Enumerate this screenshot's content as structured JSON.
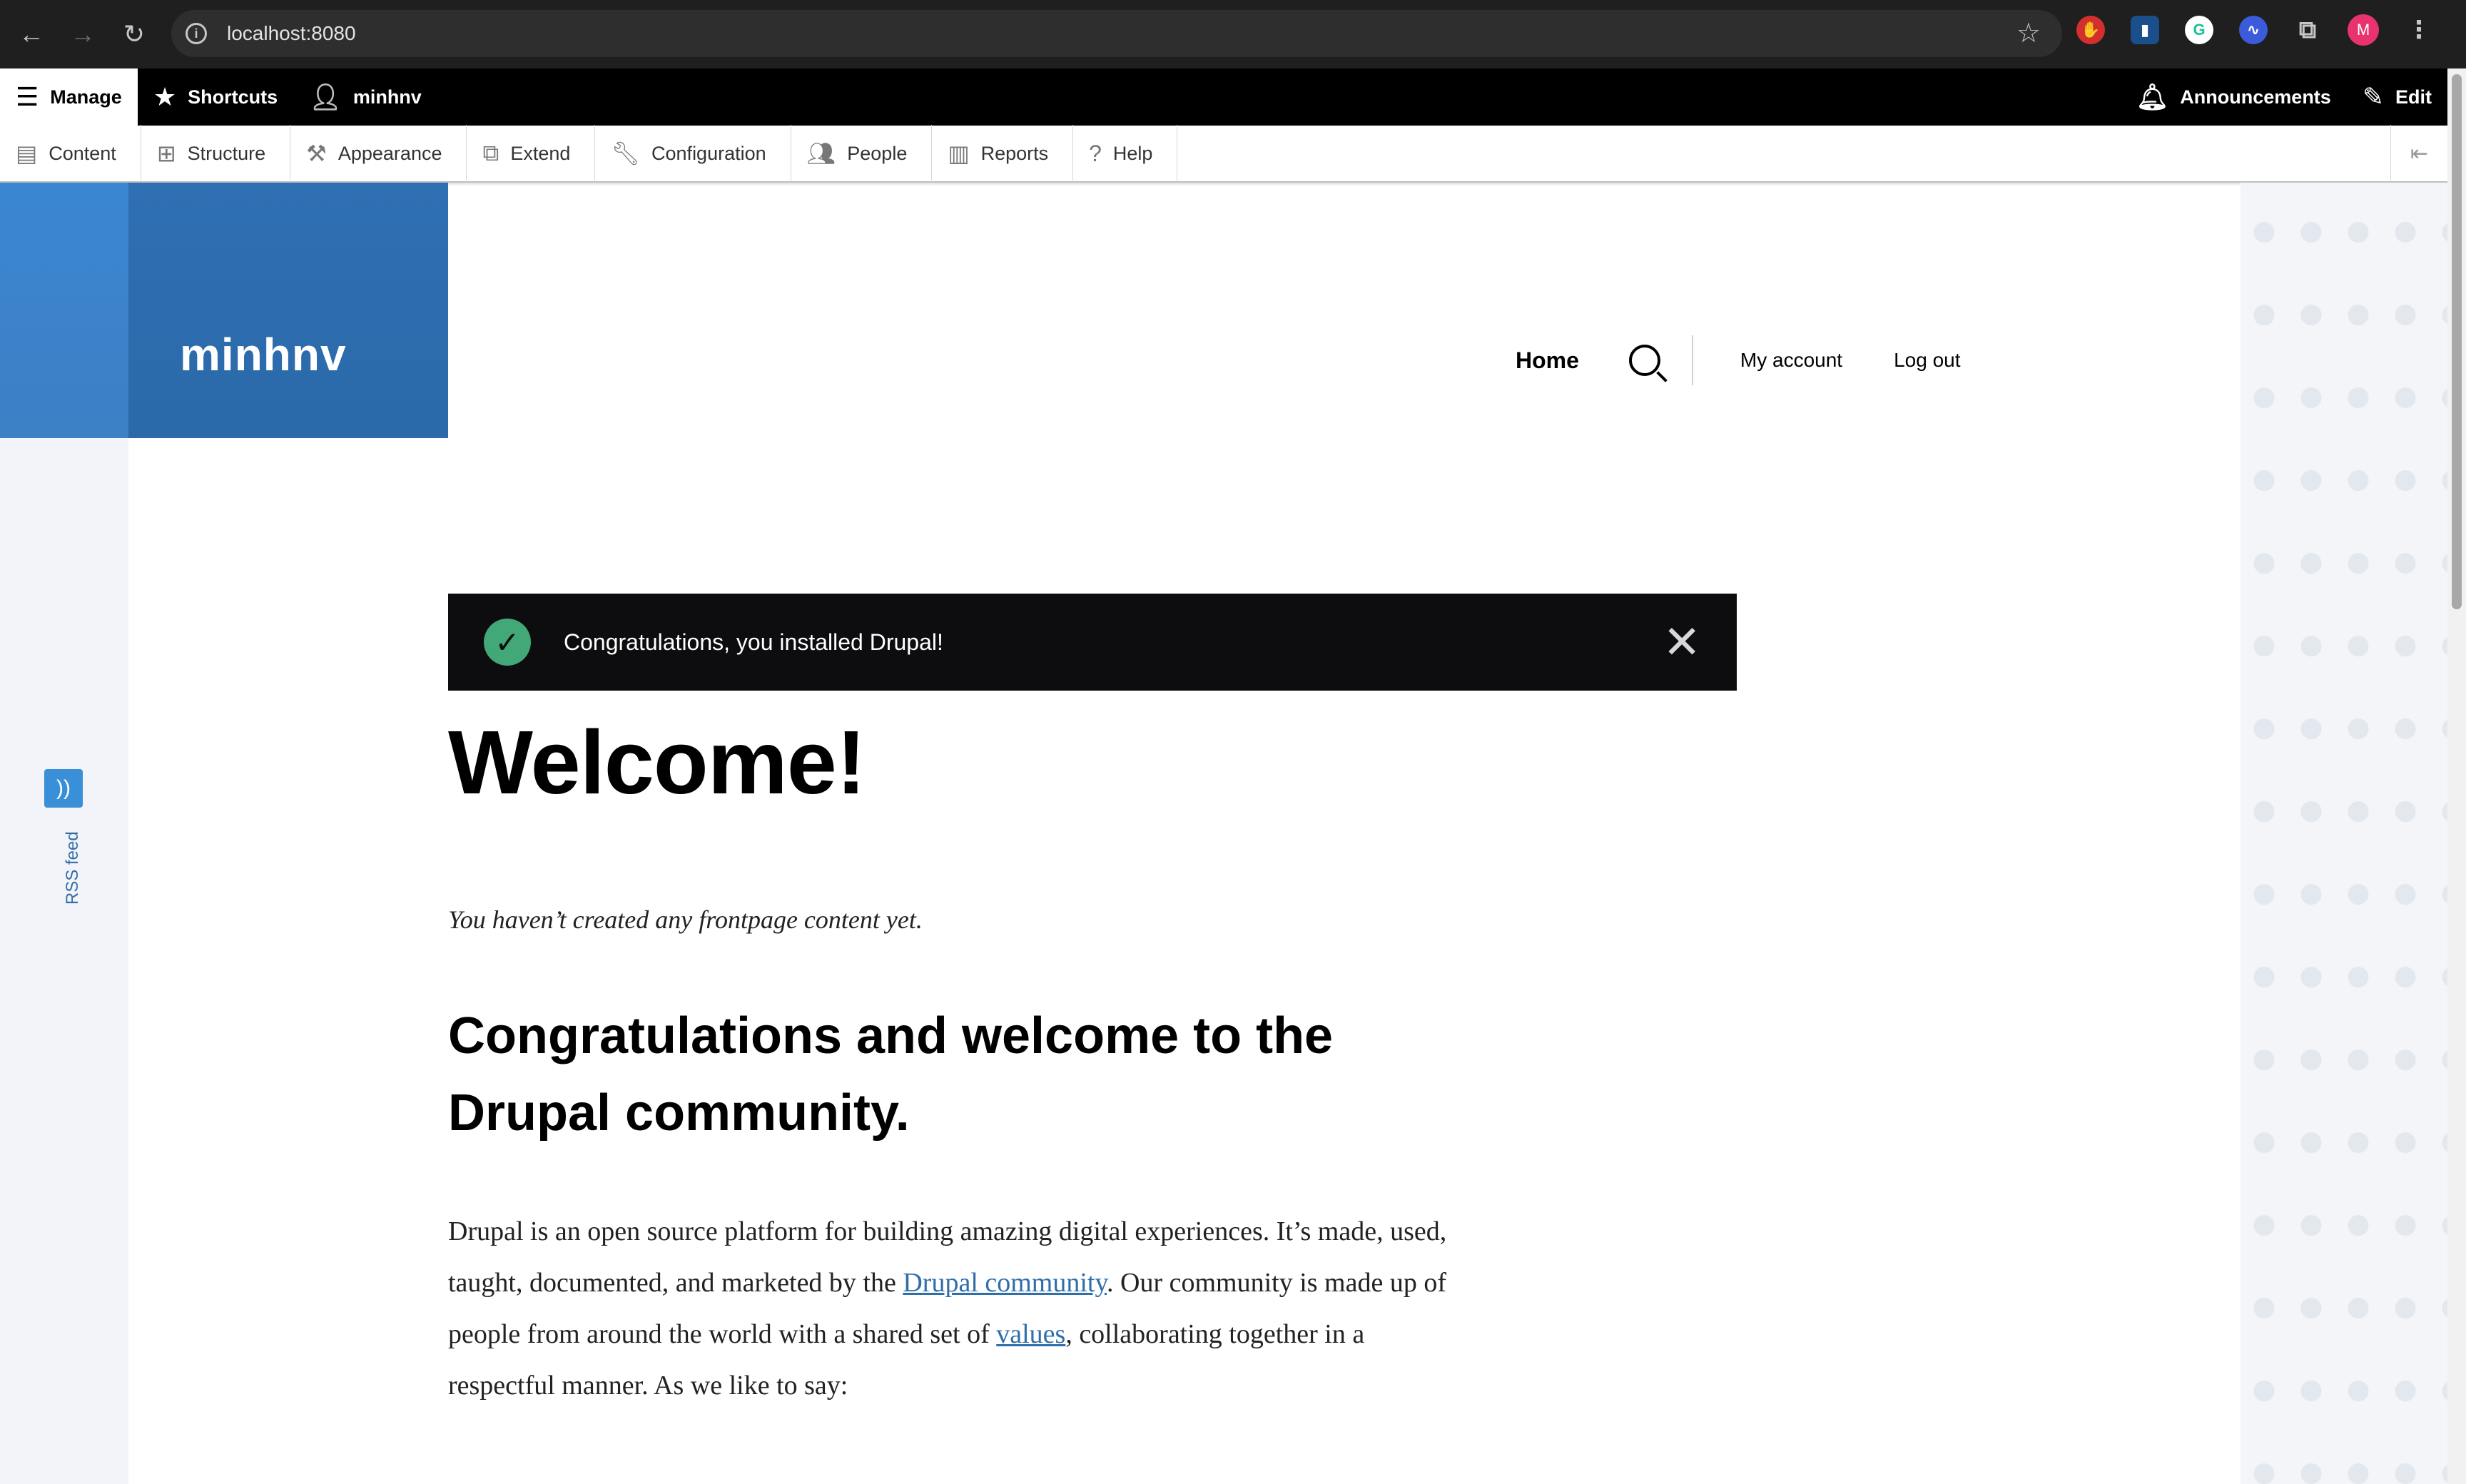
{
  "browser": {
    "url": "localhost:8080",
    "profile_initial": "M",
    "extensions": [
      "red-hand-extension",
      "bitwarden-extension",
      "grammarly-extension",
      "voice-extension",
      "puzzle-extensions"
    ]
  },
  "toolbar": {
    "manage": "Manage",
    "shortcuts": "Shortcuts",
    "user": "minhnv",
    "announcements": "Announcements",
    "edit": "Edit",
    "tray": [
      {
        "label": "Content",
        "icon": "document-icon"
      },
      {
        "label": "Structure",
        "icon": "sitemap-icon"
      },
      {
        "label": "Appearance",
        "icon": "paintbrush-icon"
      },
      {
        "label": "Extend",
        "icon": "puzzle-icon"
      },
      {
        "label": "Configuration",
        "icon": "wrench-icon"
      },
      {
        "label": "People",
        "icon": "people-icon"
      },
      {
        "label": "Reports",
        "icon": "bar-chart-icon"
      },
      {
        "label": "Help",
        "icon": "help-icon"
      }
    ]
  },
  "site": {
    "name": "minhnv",
    "rss_label": "RSS feed"
  },
  "nav": {
    "home": "Home",
    "my_account": "My account",
    "log_out": "Log out"
  },
  "message": {
    "text": "Congratulations, you installed Drupal!"
  },
  "content": {
    "title": "Welcome!",
    "frontpage_note": "You haven’t created any frontpage content yet.",
    "heading": "Congratulations and welcome to the Drupal community.",
    "paragraph_start": "Drupal is an open source platform for building amazing digital experiences. It’s made, used, taught, documented, and marketed by the ",
    "link_community": "Drupal community",
    "paragraph_mid": ". Our community is made up of people from around the world with a shared set of ",
    "link_values": "values",
    "paragraph_end": ", collaborating together in a respectful manner. As we like to say:"
  },
  "colors": {
    "brand_blue": "#3b86d1",
    "link_blue": "#2f6ea9",
    "success_green": "#42a877",
    "message_bg": "#0d0d0f"
  }
}
